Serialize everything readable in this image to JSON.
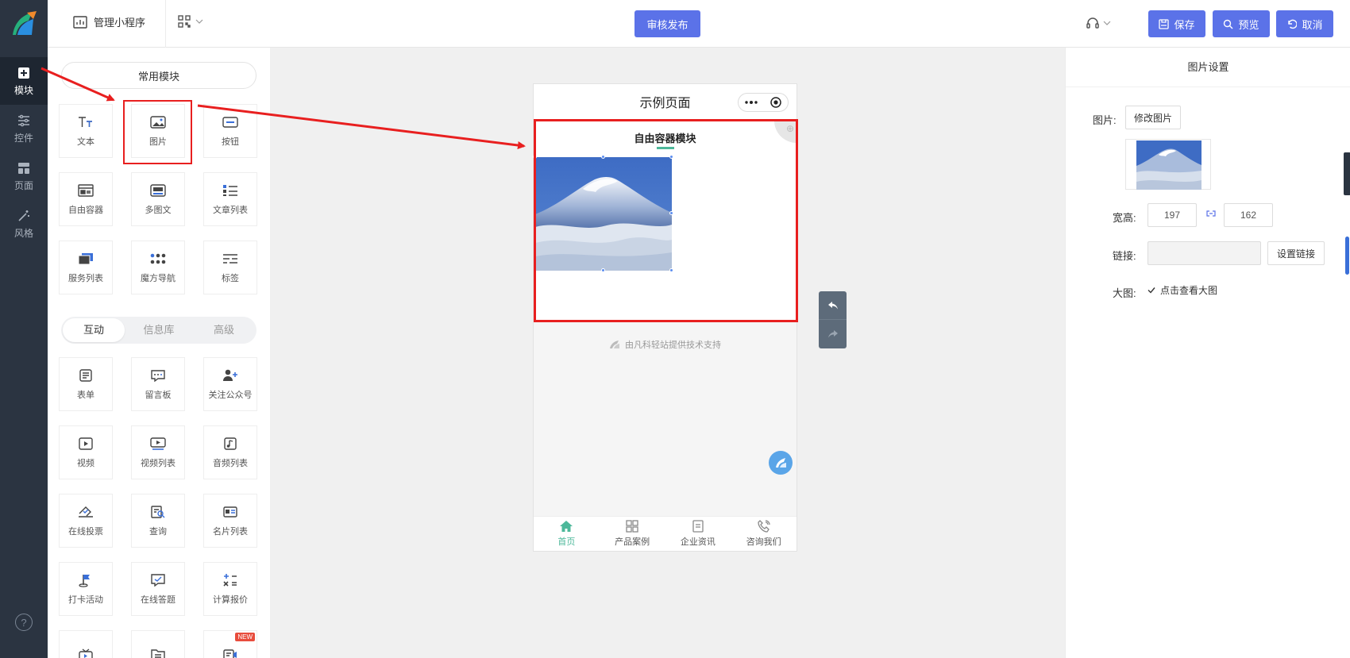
{
  "rail": {
    "items": [
      {
        "label": "模块",
        "icon": "plus-square-icon",
        "active": true
      },
      {
        "label": "控件",
        "icon": "sliders-icon",
        "active": false
      },
      {
        "label": "页面",
        "icon": "layout-icon",
        "active": false
      },
      {
        "label": "风格",
        "icon": "magic-wand-icon",
        "active": false
      }
    ],
    "help": "?"
  },
  "topbar": {
    "manage_label": "管理小程序",
    "publish_label": "审核发布",
    "save_label": "保存",
    "preview_label": "预览",
    "cancel_label": "取消"
  },
  "modules": {
    "common_label": "常用模块",
    "common": [
      {
        "label": "文本",
        "icon": "text-icon"
      },
      {
        "label": "图片",
        "icon": "image-icon"
      },
      {
        "label": "按钮",
        "icon": "button-icon"
      },
      {
        "label": "自由容器",
        "icon": "container-icon"
      },
      {
        "label": "多图文",
        "icon": "multi-image-text-icon"
      },
      {
        "label": "文章列表",
        "icon": "article-list-icon"
      },
      {
        "label": "服务列表",
        "icon": "service-list-icon"
      },
      {
        "label": "魔方导航",
        "icon": "cube-nav-icon"
      },
      {
        "label": "标签",
        "icon": "tag-icon"
      }
    ],
    "tabs": [
      "互动",
      "信息库",
      "高级"
    ],
    "active_tab": 0,
    "interactive": [
      {
        "label": "表单",
        "icon": "form-icon"
      },
      {
        "label": "留言板",
        "icon": "message-board-icon"
      },
      {
        "label": "关注公众号",
        "icon": "follow-account-icon"
      },
      {
        "label": "视频",
        "icon": "video-icon"
      },
      {
        "label": "视频列表",
        "icon": "video-list-icon"
      },
      {
        "label": "音频列表",
        "icon": "audio-list-icon"
      },
      {
        "label": "在线投票",
        "icon": "vote-icon"
      },
      {
        "label": "查询",
        "icon": "query-icon"
      },
      {
        "label": "名片列表",
        "icon": "card-list-icon"
      },
      {
        "label": "打卡活动",
        "icon": "checkin-icon"
      },
      {
        "label": "在线答题",
        "icon": "quiz-icon"
      },
      {
        "label": "计算报价",
        "icon": "calculator-icon"
      },
      {
        "label": "",
        "icon": "tv-icon"
      },
      {
        "label": "",
        "icon": "list-icon"
      },
      {
        "label": "",
        "icon": "live-icon",
        "badge": "NEW"
      }
    ]
  },
  "phone": {
    "page_title": "示例页面",
    "container_title": "自由容器模块",
    "powered_by": "由凡科轻站提供技术支持",
    "tabbar": [
      {
        "label": "首页",
        "icon": "home-icon",
        "active": true
      },
      {
        "label": "产品案例",
        "icon": "grid-icon",
        "active": false
      },
      {
        "label": "企业资讯",
        "icon": "news-icon",
        "active": false
      },
      {
        "label": "咨询我们",
        "icon": "phone-icon",
        "active": false
      }
    ]
  },
  "settings": {
    "title": "图片设置",
    "image_label": "图片:",
    "change_image": "修改图片",
    "size_label": "宽高:",
    "width": "197",
    "height": "162",
    "link_label": "链接:",
    "link_value": "",
    "set_link": "设置链接",
    "large_label": "大图:",
    "large_option": "点击查看大图",
    "large_checked": true
  },
  "colors": {
    "accent": "#5b72e8",
    "rail": "#2b3441",
    "highlight": "#e81f1f",
    "tab_active": "#4db89a"
  }
}
